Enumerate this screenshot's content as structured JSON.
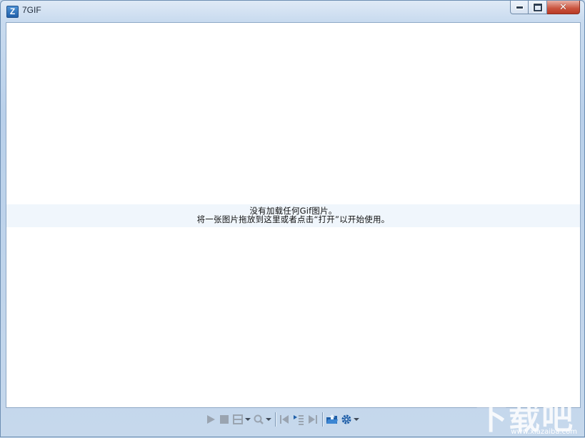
{
  "window": {
    "title": "7GIF",
    "app_icon_letter": "Z"
  },
  "caption_buttons": {
    "minimize": "minimize-icon",
    "maximize": "maximize-icon",
    "close": "✕"
  },
  "message": {
    "line1": "没有加载任何Gif图片。",
    "line2": "将一张图片拖放到这里或者点击“打开”以开始使用。"
  },
  "toolbar": {
    "buttons": [
      {
        "name": "play-icon",
        "enabled": false
      },
      {
        "name": "stop-icon",
        "enabled": false
      },
      {
        "name": "frame-view-icon",
        "enabled": false,
        "dropdown": true
      },
      {
        "name": "zoom-icon",
        "enabled": false,
        "dropdown": true
      },
      {
        "name": "first-frame-icon",
        "enabled": false
      },
      {
        "name": "next-frame-icon",
        "enabled": false
      },
      {
        "name": "last-frame-icon",
        "enabled": false
      },
      {
        "name": "open-folder-icon",
        "enabled": true
      },
      {
        "name": "settings-gear-icon",
        "enabled": true,
        "dropdown": true
      }
    ]
  },
  "watermark": {
    "text": "下载吧",
    "sub": "www.xiazaiba.com"
  },
  "colors": {
    "frame": "#c7d8eb",
    "client_bg": "#ffffff",
    "message_band": "#f0f6fc",
    "disabled_icon": "#9aa4b0",
    "enabled_icon": "#1f5fa8"
  }
}
